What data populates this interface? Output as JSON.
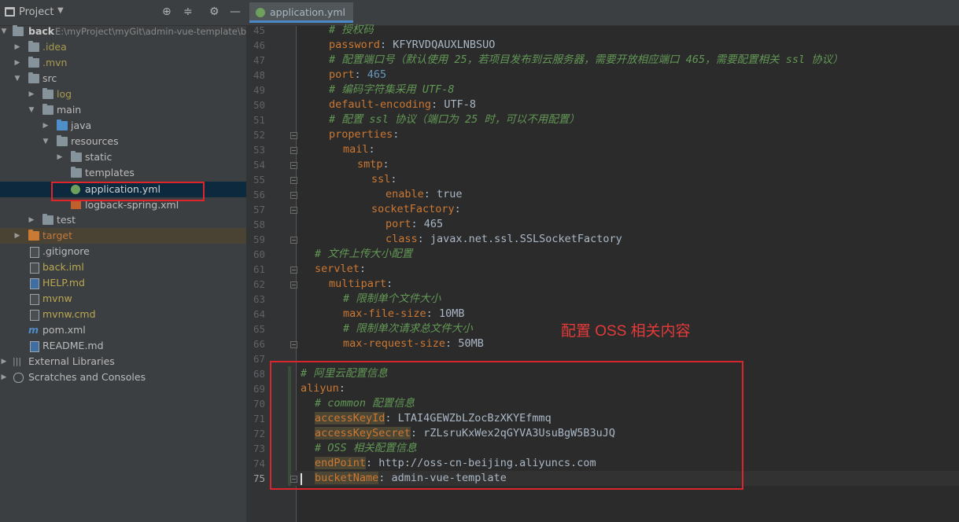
{
  "sidebar": {
    "title": "Project",
    "tree": [
      {
        "label": "back",
        "hint": "E:\\myProject\\myGit\\admin-vue-template\\b"
      },
      {
        "label": ".idea"
      },
      {
        "label": ".mvn"
      },
      {
        "label": "src"
      },
      {
        "label": "log"
      },
      {
        "label": "main"
      },
      {
        "label": "java"
      },
      {
        "label": "resources"
      },
      {
        "label": "static"
      },
      {
        "label": "templates"
      },
      {
        "label": "application.yml"
      },
      {
        "label": "logback-spring.xml"
      },
      {
        "label": "test"
      },
      {
        "label": "target"
      },
      {
        "label": ".gitignore"
      },
      {
        "label": "back.iml"
      },
      {
        "label": "HELP.md"
      },
      {
        "label": "mvnw"
      },
      {
        "label": "mvnw.cmd"
      },
      {
        "label": "pom.xml"
      },
      {
        "label": "README.md"
      },
      {
        "label": "External Libraries"
      },
      {
        "label": "Scratches and Consoles"
      }
    ]
  },
  "editor": {
    "tab_label": "application.yml",
    "annotation": "配置 OSS 相关内容",
    "line_numbers": [
      "45",
      "46",
      "47",
      "48",
      "49",
      "50",
      "51",
      "52",
      "53",
      "54",
      "55",
      "56",
      "57",
      "58",
      "59",
      "60",
      "61",
      "62",
      "63",
      "64",
      "65",
      "66",
      "67",
      "68",
      "69",
      "70",
      "71",
      "72",
      "73",
      "74",
      "75"
    ],
    "lines": {
      "l45": "# 授权码",
      "l46k": "password",
      "l46v": "KFYRVDQAUXLNBSUO",
      "l47": "# 配置端口号（默认使用 25，若项目发布到云服务器，需要开放相应端口 465，需要配置相关 ssl 协议）",
      "l48k": "port",
      "l48v": "465",
      "l49": "# 编码字符集采用 UTF-8",
      "l50k": "default-encoding",
      "l50v": "UTF-8",
      "l51": "# 配置 ssl 协议（端口为 25 时，可以不用配置）",
      "l52k": "properties",
      "l53k": "mail",
      "l54k": "smtp",
      "l55k": "ssl",
      "l56k": "enable",
      "l56v": "true",
      "l57k": "socketFactory",
      "l58k": "port",
      "l58v": "465",
      "l59k": "class",
      "l59v": "javax.net.ssl.SSLSocketFactory",
      "l60": "# 文件上传大小配置",
      "l61k": "servlet",
      "l62k": "multipart",
      "l63": "# 限制单个文件大小",
      "l64k": "max-file-size",
      "l64v": "10MB",
      "l65": "# 限制单次请求总文件大小",
      "l66k": "max-request-size",
      "l66v": "50MB",
      "l68": "# 阿里云配置信息",
      "l69k": "aliyun",
      "l70": "# common 配置信息",
      "l71k": "accessKeyId",
      "l71v": "LTAI4GEWZbLZocBzXKYEfmmq",
      "l72k": "accessKeySecret",
      "l72v": "rZLsruKxWex2qGYVA3UsuBgW5B3uJQ",
      "l73": "# OSS 相关配置信息",
      "l74k": "endPoint",
      "l74v": "http://oss-cn-beijing.aliyuncs.com",
      "l75k": "bucketName",
      "l75v": "admin-vue-template"
    }
  },
  "colors": {
    "keyword": "#cc7832",
    "comment": "#629755",
    "number": "#6897bb",
    "highlight_box": "#d8262c"
  },
  "icons": [
    "project-icon",
    "crosshair-icon",
    "collapse-icon",
    "gear-icon",
    "minimize-icon",
    "folder-icon",
    "yaml-file-icon",
    "xml-file-icon",
    "markdown-file-icon",
    "library-icon",
    "scratch-icon"
  ]
}
